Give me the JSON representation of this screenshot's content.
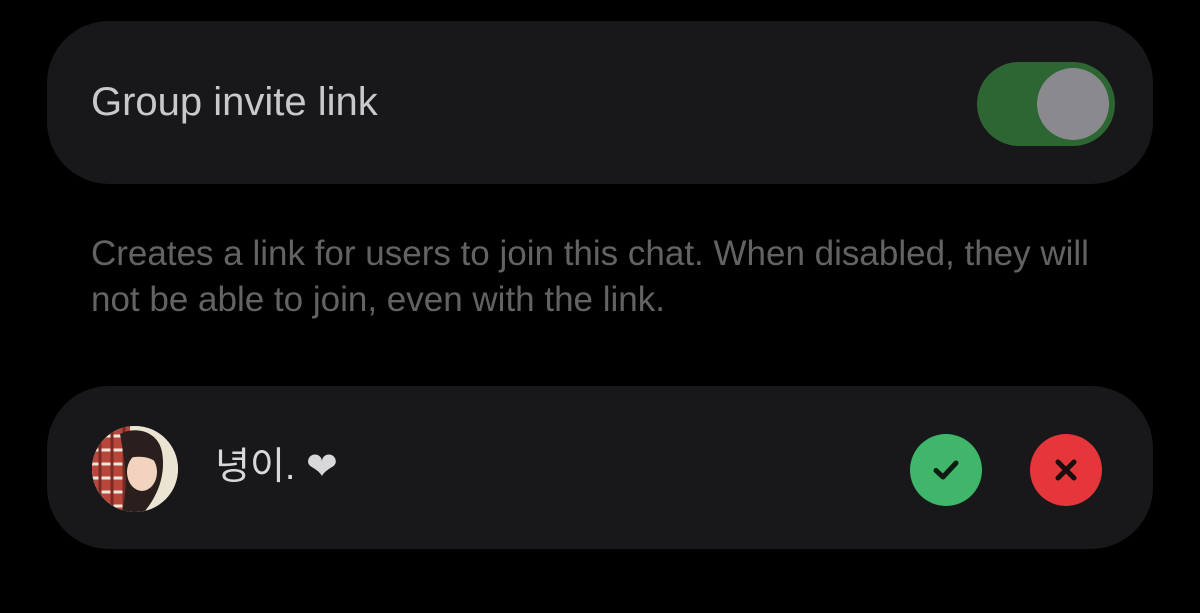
{
  "settings": {
    "invite_link_label": "Group invite link",
    "invite_link_enabled": true,
    "invite_link_description": "Creates a link for users to join this chat. When disabled, they will not be able to join, even with the link."
  },
  "join_request": {
    "user_name": "녕이. ❤",
    "avatar_icon": "profile-photo",
    "approve_icon": "checkmark-icon",
    "decline_icon": "x-icon"
  },
  "colors": {
    "background": "#000000",
    "card": "#18181b",
    "toggle_on": "#2d6533",
    "toggle_knob": "#8a8a8e",
    "approve": "#3fb66a",
    "decline": "#e5363b"
  }
}
